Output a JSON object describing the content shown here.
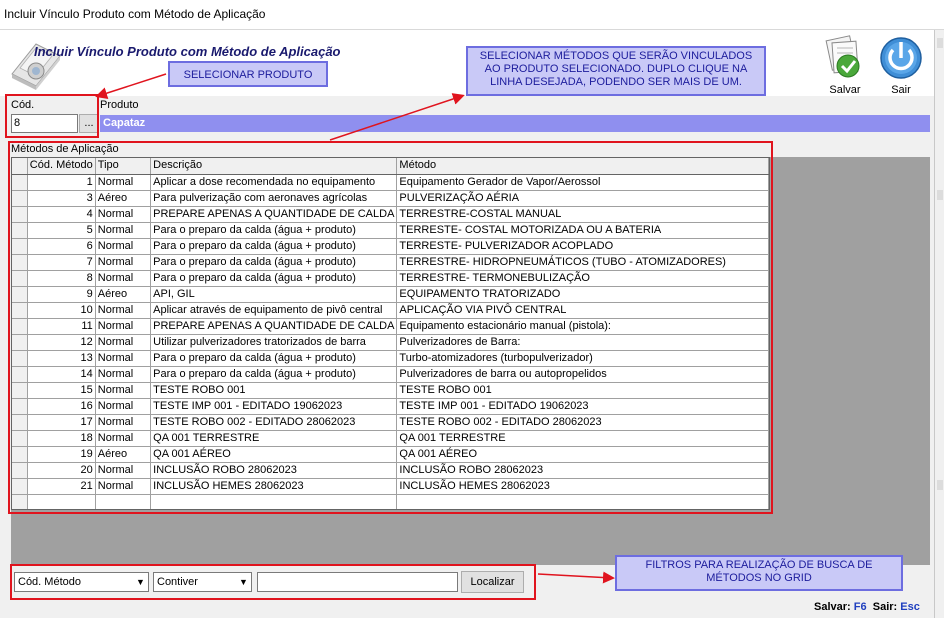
{
  "window": {
    "title": "Incluir Vínculo Produto com Método de Aplicação"
  },
  "header": {
    "title": "Incluir Vínculo Produto com Método de Aplicação"
  },
  "toolbar": {
    "save_label": "Salvar",
    "exit_label": "Sair"
  },
  "form": {
    "cod_label": "Cód.",
    "cod_value": "8",
    "ellipsis_label": "...",
    "produto_label": "Produto",
    "produto_value": "Capataz",
    "metodos_label": "Métodos de Aplicação"
  },
  "grid": {
    "columns": [
      "Cód. Método",
      "Tipo",
      "Descrição",
      "Método"
    ],
    "rows": [
      {
        "cod": "1",
        "tipo": "Normal",
        "desc": "Aplicar a dose recomendada no equipamento",
        "metodo": "Equipamento Gerador de Vapor/Aerossol"
      },
      {
        "cod": "3",
        "tipo": "Aéreo",
        "desc": "Para pulverização com aeronaves agrícolas",
        "metodo": "PULVERIZAÇÃO AÉRIA"
      },
      {
        "cod": "4",
        "tipo": "Normal",
        "desc": "PREPARE APENAS A QUANTIDADE DE CALDA",
        "metodo": "TERRESTRE-COSTAL MANUAL"
      },
      {
        "cod": "5",
        "tipo": "Normal",
        "desc": "Para o preparo da calda (água + produto)",
        "metodo": "TERRESTE- COSTAL MOTORIZADA OU A BATERIA"
      },
      {
        "cod": "6",
        "tipo": "Normal",
        "desc": "Para o preparo da calda (água + produto)",
        "metodo": "TERRESTE- PULVERIZADOR ACOPLADO"
      },
      {
        "cod": "7",
        "tipo": "Normal",
        "desc": "Para o preparo da calda (água + produto)",
        "metodo": "TERRESTRE- HIDROPNEUMÁTICOS (TUBO - ATOMIZADORES)"
      },
      {
        "cod": "8",
        "tipo": "Normal",
        "desc": "Para o preparo da calda (água + produto)",
        "metodo": "TERRESTRE- TERMONEBULIZAÇÃO"
      },
      {
        "cod": "9",
        "tipo": "Aéreo",
        "desc": "API, GIL",
        "metodo": "EQUIPAMENTO TRATORIZADO"
      },
      {
        "cod": "10",
        "tipo": "Normal",
        "desc": "Aplicar através de equipamento de pivô central",
        "metodo": "APLICAÇÃO VIA PIVÔ CENTRAL"
      },
      {
        "cod": "11",
        "tipo": "Normal",
        "desc": "PREPARE APENAS A QUANTIDADE DE CALDA",
        "metodo": "Equipamento estacionário manual (pistola):"
      },
      {
        "cod": "12",
        "tipo": "Normal",
        "desc": "Utilizar pulverizadores tratorizados de barra",
        "metodo": "Pulverizadores de Barra:"
      },
      {
        "cod": "13",
        "tipo": "Normal",
        "desc": "Para o preparo da calda (água + produto)",
        "metodo": "Turbo-atomizadores (turbopulverizador)"
      },
      {
        "cod": "14",
        "tipo": "Normal",
        "desc": "Para o preparo da calda (água + produto)",
        "metodo": "Pulverizadores de barra ou autopropelidos"
      },
      {
        "cod": "15",
        "tipo": "Normal",
        "desc": "TESTE ROBO 001",
        "metodo": "TESTE ROBO 001"
      },
      {
        "cod": "16",
        "tipo": "Normal",
        "desc": "TESTE IMP 001 - EDITADO 19062023",
        "metodo": "TESTE IMP 001 - EDITADO 19062023"
      },
      {
        "cod": "17",
        "tipo": "Normal",
        "desc": "TESTE ROBO 002 - EDITADO 28062023",
        "metodo": "TESTE ROBO 002 - EDITADO 28062023"
      },
      {
        "cod": "18",
        "tipo": "Normal",
        "desc": "QA 001 TERRESTRE",
        "metodo": "QA 001 TERRESTRE"
      },
      {
        "cod": "19",
        "tipo": "Aéreo",
        "desc": "QA 001 AÉREO",
        "metodo": "QA 001 AÉREO"
      },
      {
        "cod": "20",
        "tipo": "Normal",
        "desc": "INCLUSÃO ROBO 28062023",
        "metodo": "INCLUSÃO ROBO 28062023"
      },
      {
        "cod": "21",
        "tipo": "Normal",
        "desc": "INCLUSÃO HEMES 28062023",
        "metodo": "INCLUSÃO HEMES 28062023"
      }
    ]
  },
  "filters": {
    "field_select": "Cód. Método",
    "operator_select": "Contiver",
    "search_value": "",
    "search_button": "Localizar"
  },
  "shortcuts": {
    "save_label": "Salvar:",
    "save_key": "F6",
    "exit_label": "Sair:",
    "exit_key": "Esc"
  },
  "annotations": {
    "select_product": "SELECIONAR PRODUTO",
    "select_methods": "SELECIONAR MÉTODOS QUE SERÃO VINCULADOS AO PRODUTO SELECIONADO. DUPLO CLIQUE NA LINHA DESEJADA, PODENDO SER MAIS DE UM.",
    "filters": "FILTROS PARA REALIZAÇÃO DE BUSCA DE MÉTODOS NO GRID"
  },
  "colors": {
    "accent": "#1a1a6e",
    "product_highlight": "#8f8fef",
    "annotation_fill": "#c9c9f7",
    "annotation_border": "#6d6de0",
    "annotation_red": "#e0141e",
    "shortcut_key": "#1f3fbf",
    "grid_background": "#a0a0a0"
  }
}
